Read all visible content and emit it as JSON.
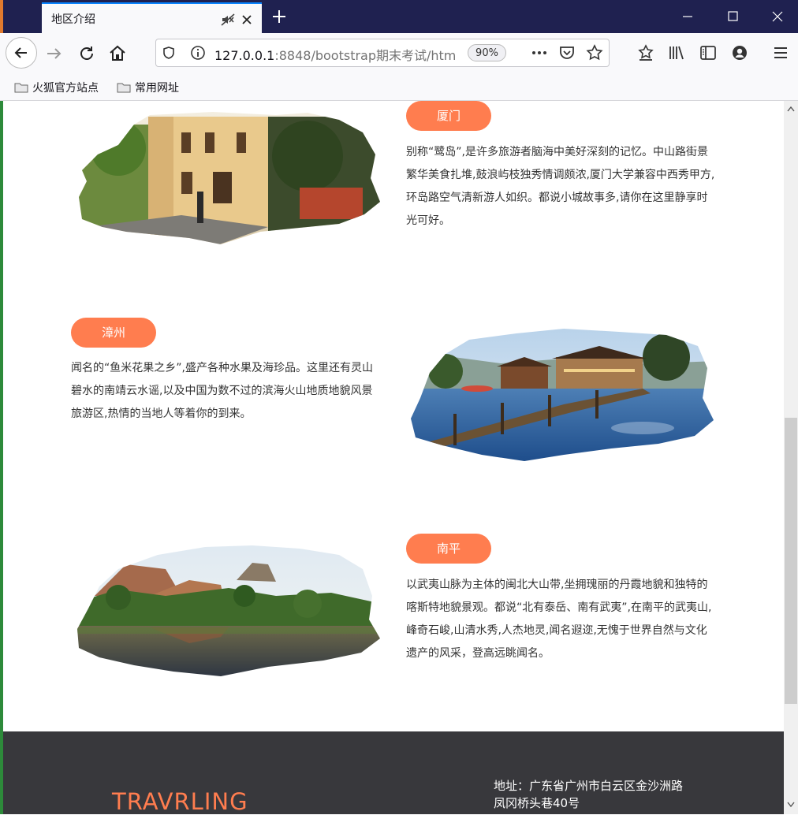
{
  "browser": {
    "tab_title": "地区介绍",
    "url_host": "127.0.0.1",
    "url_rest": ":8848/bootstrap期末考试/htm",
    "zoom": "90%",
    "bookmarks": [
      "火狐官方站点",
      "常用网址"
    ]
  },
  "cities": [
    {
      "name": "厦门",
      "description": "别称“鹭岛”,是许多旅游者脑海中美好深刻的记忆。中山路街景繁华美食扎堆,鼓浪屿枝独秀情调颇浓,厦门大学兼容中西秀甲方,环岛路空气清新游人如织。都说小城故事多,请你在这里静享时光可好。"
    },
    {
      "name": "漳州",
      "description": "闻名的“鱼米花果之乡”,盛产各种水果及海珍品。这里还有灵山碧水的南靖云水谣,以及中国为数不过的滨海火山地质地貌风景旅游区,热情的当地人等着你的到来。"
    },
    {
      "name": "南平",
      "description": "以武夷山脉为主体的闽北大山带,坐拥瑰丽的丹霞地貌和独特的喀斯特地貌景观。都说“北有泰岳、南有武夷”,在南平的武夷山,峰奇石峻,山清水秀,人杰地灵,闻名遐迩,无愧于世界自然与文化遗产的风采，登高远眺闻名。"
    }
  ],
  "footer": {
    "brand": "TRAVRLING",
    "address": "地址：广东省广州市白云区金沙洲路凤冈桥头巷40号"
  },
  "colors": {
    "accent": "#ff7d4f",
    "footer_bg": "#38383c",
    "tabbar_bg": "#1f2150"
  }
}
